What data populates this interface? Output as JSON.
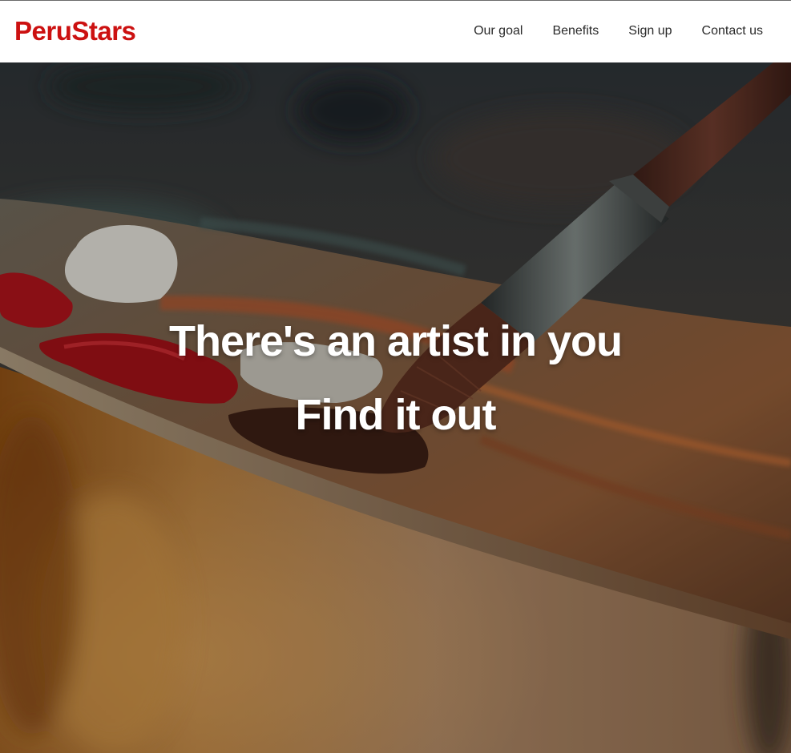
{
  "brand": {
    "name": "PeruStars",
    "color": "#cc1111"
  },
  "nav": {
    "items": [
      {
        "label": "Our goal"
      },
      {
        "label": "Benefits"
      },
      {
        "label": "Sign up"
      },
      {
        "label": "Contact us"
      }
    ]
  },
  "hero": {
    "headline": "There's an artist in you",
    "subheadline": "Find it out",
    "image_subject": "paint palette with brush",
    "text_color": "#ffffff"
  }
}
